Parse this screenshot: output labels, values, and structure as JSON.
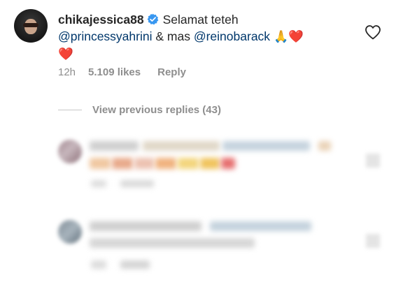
{
  "comment": {
    "username": "chikajessica88",
    "text_before": "Selamat teteh",
    "mention1": "@princessyahrini",
    "connector": "& mas",
    "mention2": "@reinobarack",
    "emoji_pray": "🙏",
    "emoji_heart1": "❤️",
    "emoji_heart2": "❤️",
    "time": "12h",
    "likes": "5.109 likes",
    "reply": "Reply"
  },
  "view_previous": {
    "label": "View previous replies (43)"
  },
  "colors": {
    "mention": "#00376b",
    "meta": "#8e8e8e",
    "verified": "#3897f0",
    "heart": "#e0245e"
  },
  "icons": {
    "verified": "verified-badge-icon",
    "like": "heart-outline-icon"
  }
}
